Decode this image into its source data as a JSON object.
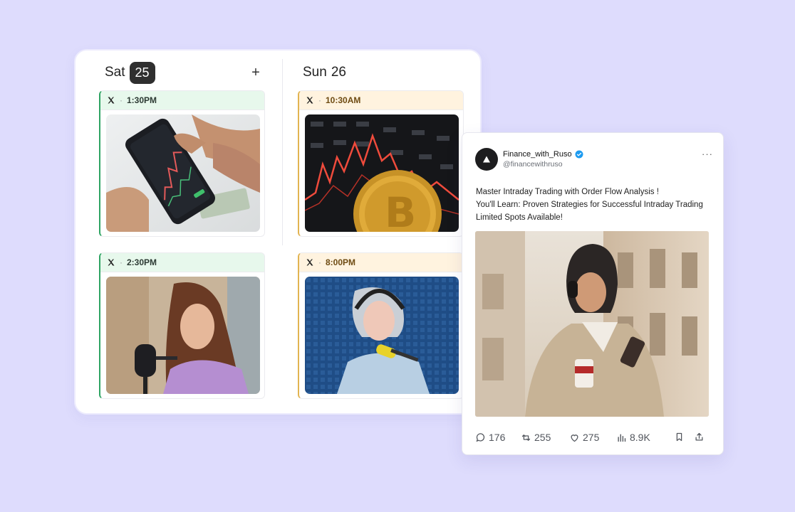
{
  "calendar": {
    "days": [
      {
        "weekday": "Sat",
        "date": "25"
      },
      {
        "weekday": "Sun",
        "date": "26"
      }
    ],
    "add_label": "+",
    "posts": [
      {
        "network_icon": "x-logo-icon",
        "time": "1:30PM",
        "status_color": "#2fa463",
        "image": "hands holding smartphone with stock chart"
      },
      {
        "network_icon": "x-logo-icon",
        "time": "10:30AM",
        "status_color": "#e2b451",
        "image": "bitcoin coin over red price chart"
      },
      {
        "network_icon": "x-logo-icon",
        "time": "2:30PM",
        "status_color": "#2fa463",
        "image": "woman speaking into podcast microphone"
      },
      {
        "network_icon": "x-logo-icon",
        "time": "8:00PM",
        "status_color": "#e2b451",
        "image": "woman with headphones in recording booth"
      }
    ]
  },
  "tweet": {
    "name": "Finance_with_Ruso",
    "handle": "@financewithruso",
    "verified": true,
    "more_label": "···",
    "lines": [
      "Master Intraday Trading with Order Flow Analysis !",
      "You'll Learn: Proven Strategies for Successful Intraday Trading",
      "Limited Spots Available!"
    ],
    "image": "woman in headphones with coffee and phone",
    "metrics": {
      "replies": "176",
      "retweets": "255",
      "likes": "275",
      "views": "8.9K"
    }
  },
  "colors": {
    "background": "#dedcfd",
    "sat_badge": "#2f2f2f",
    "verified_badge": "#1d9bf0",
    "green_accent": "#2fa463",
    "amber_accent": "#e2b451"
  }
}
